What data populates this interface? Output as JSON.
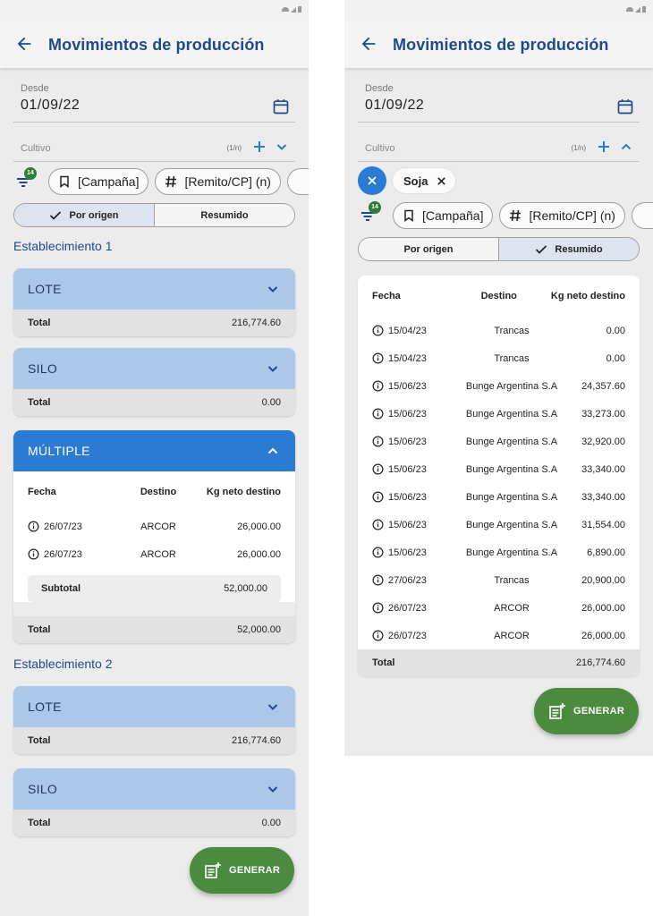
{
  "app_title": "Movimientos de producción",
  "form": {
    "date_label": "Desde",
    "date_value": "01/09/22",
    "cultivo_label": "Cultivo",
    "cultivo_count": "(1/n)"
  },
  "filters": {
    "badge": "14",
    "chips": [
      "[Campaña]",
      "[Remito/CP] (n)"
    ]
  },
  "segments": {
    "por_origen": "Por origen",
    "resumido": "Resumido"
  },
  "table_headers": {
    "fecha": "Fecha",
    "destino": "Destino",
    "kg": "Kg neto destino"
  },
  "labels": {
    "total": "Total",
    "subtotal": "Subtotal"
  },
  "fab_label": "GENERAR",
  "left": {
    "establecimientos": [
      {
        "name": "Establecimiento 1",
        "cards": [
          {
            "title": "LOTE",
            "total": "216,774.60"
          },
          {
            "title": "SILO",
            "total": "0.00"
          },
          {
            "title": "MÚLTIPLE",
            "rows": [
              {
                "fecha": "26/07/23",
                "destino": "ARCOR",
                "kg": "26,000.00"
              },
              {
                "fecha": "26/07/23",
                "destino": "ARCOR",
                "kg": "26,000.00"
              }
            ],
            "subtotal": "52,000.00",
            "total": "52,000.00"
          }
        ]
      },
      {
        "name": "Establecimiento 2",
        "cards": [
          {
            "title": "LOTE",
            "total": "216,774.60"
          },
          {
            "title": "SILO",
            "total": "0.00"
          }
        ]
      }
    ]
  },
  "right": {
    "tag": "Soja",
    "rows": [
      {
        "fecha": "15/04/23",
        "destino": "Trancas",
        "kg": "0.00"
      },
      {
        "fecha": "15/04/23",
        "destino": "Trancas",
        "kg": "0.00"
      },
      {
        "fecha": "15/06/23",
        "destino": "Bunge Argentina S.A",
        "kg": "24,357.60"
      },
      {
        "fecha": "15/06/23",
        "destino": "Bunge Argentina S.A",
        "kg": "33,273.00"
      },
      {
        "fecha": "15/06/23",
        "destino": "Bunge Argentina S.A",
        "kg": "32,920.00"
      },
      {
        "fecha": "15/06/23",
        "destino": "Bunge Argentina S.A",
        "kg": "33,340.00"
      },
      {
        "fecha": "15/06/23",
        "destino": "Bunge Argentina S.A",
        "kg": "33,340.00"
      },
      {
        "fecha": "15/06/23",
        "destino": "Bunge Argentina S.A",
        "kg": "31,554.00"
      },
      {
        "fecha": "15/06/23",
        "destino": "Bunge Argentina S.A",
        "kg": "6,890.00"
      },
      {
        "fecha": "27/06/23",
        "destino": "Trancas",
        "kg": "20,900.00"
      },
      {
        "fecha": "26/07/23",
        "destino": "ARCOR",
        "kg": "26,000.00"
      },
      {
        "fecha": "26/07/23",
        "destino": "ARCOR",
        "kg": "26,000.00"
      }
    ],
    "total": "216,774.60"
  },
  "colors": {
    "primary": "#1f4a8a",
    "accent": "#2b7bd3",
    "card_header": "#abc8e8",
    "fab": "#4b8a3f",
    "badge": "#2e7d32"
  },
  "icons": [
    "back-arrow-icon",
    "calendar-icon",
    "plus-icon",
    "chevron-down-icon",
    "chevron-up-icon",
    "filter-icon",
    "bookmark-icon",
    "hash-icon",
    "check-icon",
    "info-icon",
    "close-icon",
    "report-add-icon"
  ]
}
